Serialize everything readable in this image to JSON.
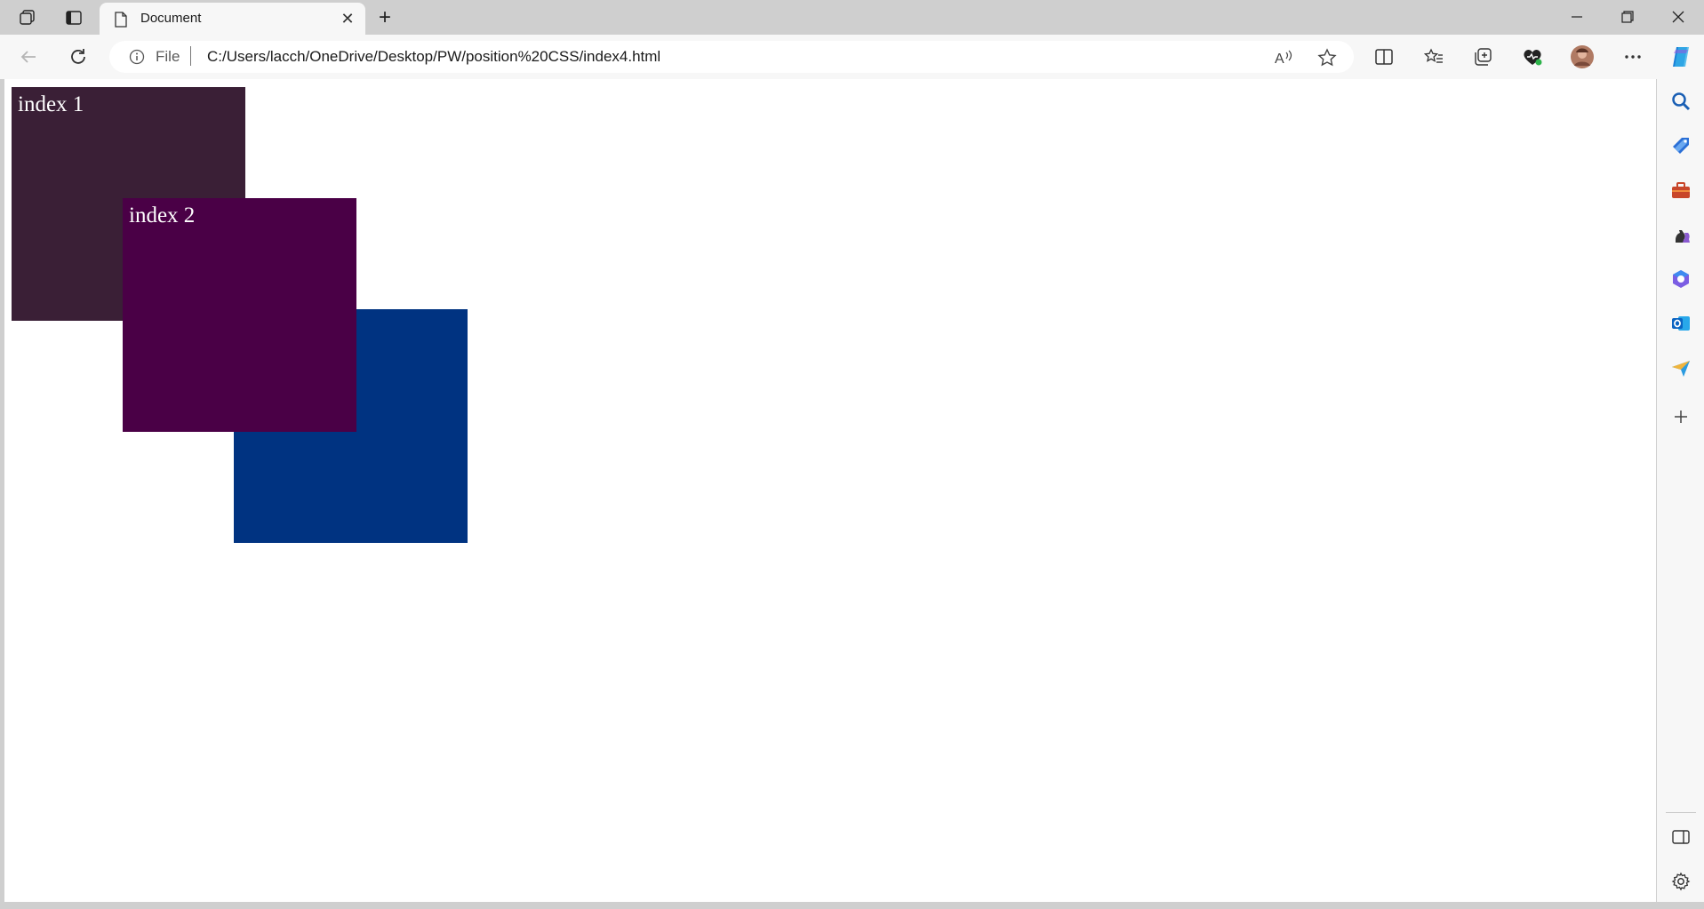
{
  "window": {
    "tab_title": "Document",
    "new_tab_symbol": "+",
    "close_symbol": "✕"
  },
  "toolbar": {
    "back_icon": "back-arrow-icon",
    "refresh_icon": "refresh-icon",
    "address": {
      "scheme_label": "File",
      "url": "C:/Users/lacch/OneDrive/Desktop/PW/position%20CSS/index4.html"
    }
  },
  "page": {
    "boxes": [
      {
        "label": "index 1",
        "color": "#3a1f36"
      },
      {
        "label": "index 2",
        "color": "#4a0046"
      },
      {
        "label": "",
        "color": "#003381"
      }
    ]
  },
  "sidebar": {
    "icons": [
      "search-icon",
      "tag-icon",
      "toolbox-icon",
      "chess-icon",
      "office-icon",
      "outlook-icon",
      "send-icon",
      "add-icon",
      "split-panel-icon",
      "settings-icon"
    ]
  }
}
